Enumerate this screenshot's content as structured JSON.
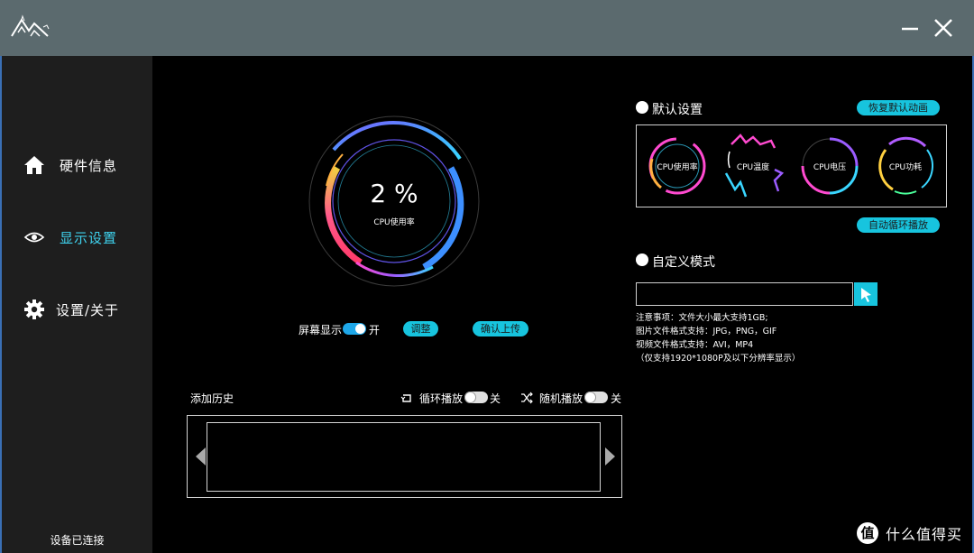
{
  "titlebar": {
    "logo": "mountain-logo",
    "min_icon": "minimize-icon",
    "close_icon": "close-icon"
  },
  "sidebar": {
    "items": [
      {
        "label": "硬件信息",
        "icon": "home-icon"
      },
      {
        "label": "显示设置",
        "icon": "eye-icon",
        "active": true
      },
      {
        "label": "设置/关于",
        "icon": "gear-icon"
      }
    ],
    "status": "设备已连接"
  },
  "gauge": {
    "value_text": "2 %",
    "label": "CPU使用率",
    "value": 2
  },
  "controls": {
    "screen_display_label": "屏幕显示",
    "screen_display_state": "开",
    "adjust_label": "调整",
    "confirm_upload_label": "确认上传"
  },
  "history": {
    "title": "添加历史",
    "loop_label": "循环播放",
    "loop_state": "关",
    "shuffle_label": "随机播放",
    "shuffle_state": "关"
  },
  "default_settings": {
    "title": "默认设置",
    "restore_label": "恢复默认动画",
    "auto_cycle_label": "自动循环播放",
    "presets": [
      "CPU使用率",
      "CPU温度",
      "CPU电压",
      "CPU功耗"
    ]
  },
  "custom_mode": {
    "title": "自定义模式",
    "input_value": "",
    "notes": [
      "注意事项：文件大小最大支持1GB;",
      "图片文件格式支持：JPG，PNG，GIF",
      "视频文件格式支持：AVI，MP4",
      "（仅支持1920*1080P及以下分辨率显示）"
    ]
  },
  "watermark": {
    "mark": "值",
    "text": "什么值得买"
  },
  "colors": {
    "accent": "#17c4de",
    "active_nav": "#3fd2ee",
    "titlebar": "#5b6a6e",
    "sidebar": "#1e1e1e"
  }
}
